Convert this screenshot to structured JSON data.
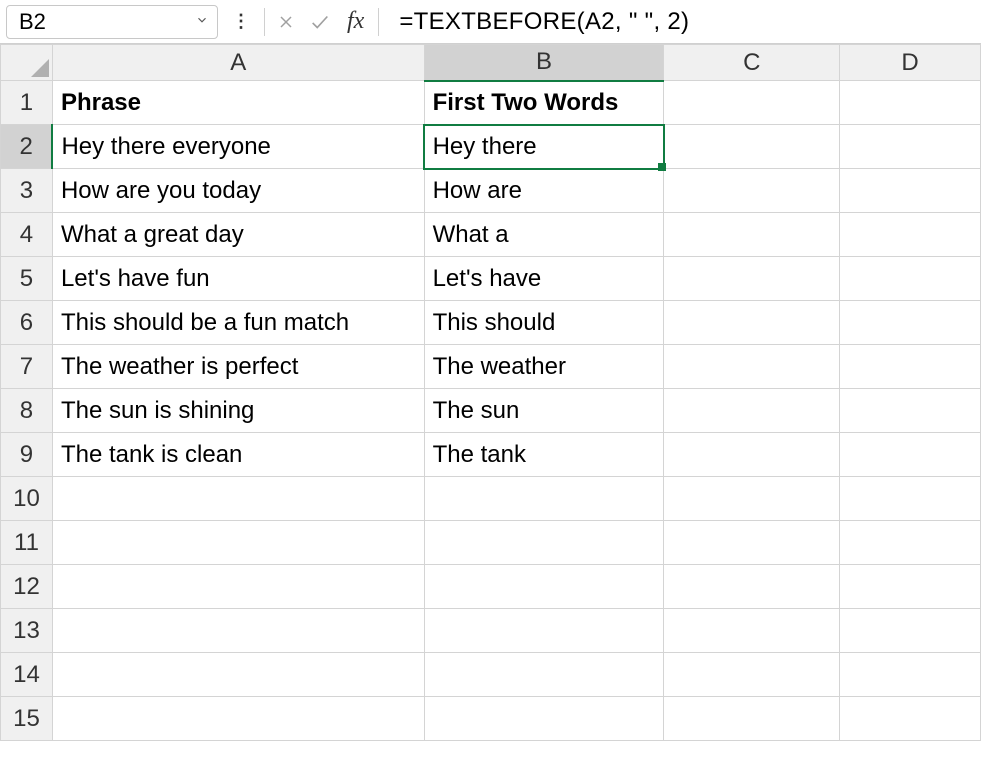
{
  "nameBox": {
    "value": "B2"
  },
  "formulaBar": {
    "value": "=TEXTBEFORE(A2, \" \", 2)"
  },
  "columns": [
    "A",
    "B",
    "C",
    "D"
  ],
  "selectedColumn": "B",
  "selectedRow": 2,
  "totalRows": 15,
  "headers": {
    "A": "Phrase",
    "B": "First Two Words"
  },
  "rows": [
    {
      "A": "Hey there everyone",
      "B": "Hey there"
    },
    {
      "A": "How are you today",
      "B": "How are"
    },
    {
      "A": "What a great day",
      "B": "What a"
    },
    {
      "A": "Let's have fun",
      "B": "Let's have"
    },
    {
      "A": "This should be a fun match",
      "B": "This should"
    },
    {
      "A": "The weather is perfect",
      "B": "The weather"
    },
    {
      "A": "The sun is shining",
      "B": "The sun"
    },
    {
      "A": "The tank is clean",
      "B": "The tank"
    }
  ],
  "chart_data": {
    "type": "table",
    "title": "",
    "columns": [
      "Phrase",
      "First Two Words"
    ],
    "rows": [
      [
        "Hey there everyone",
        "Hey there"
      ],
      [
        "How are you today",
        "How are"
      ],
      [
        "What a great day",
        "What a"
      ],
      [
        "Let's have fun",
        "Let's have"
      ],
      [
        "This should be a fun match",
        "This should"
      ],
      [
        "The weather is perfect",
        "The weather"
      ],
      [
        "The sun is shining",
        "The sun"
      ],
      [
        "The tank is clean",
        "The tank"
      ]
    ]
  }
}
